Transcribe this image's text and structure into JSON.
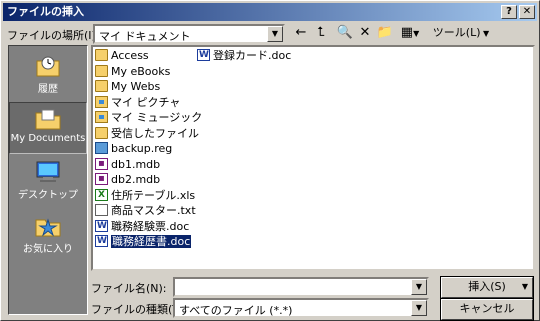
{
  "window": {
    "title": "ファイルの挿入",
    "help_label": "?",
    "close_label": "✕"
  },
  "toolbar": {
    "lookin_label": "ファイルの場所(I):",
    "lookin_value": "マイ ドキュメント",
    "back_icon": "←",
    "up_icon": "⮤",
    "search_icon": "🔍",
    "delete_icon": "✕",
    "newfolder_icon": "📁",
    "views_icon": "▦",
    "tools_label": "ツール(L)"
  },
  "places": [
    {
      "label": "履歴",
      "icon": "history-icon"
    },
    {
      "label": "My Documents",
      "icon": "my-documents-icon"
    },
    {
      "label": "デスクトップ",
      "icon": "desktop-icon"
    },
    {
      "label": "お気に入り",
      "icon": "favorites-icon"
    }
  ],
  "files": {
    "col1": [
      {
        "name": "Access",
        "type": "folder"
      },
      {
        "name": "My eBooks",
        "type": "folder"
      },
      {
        "name": "My Webs",
        "type": "folder"
      },
      {
        "name": "マイ ピクチャ",
        "type": "pic"
      },
      {
        "name": "マイ ミュージック",
        "type": "pic"
      },
      {
        "name": "受信したファイル",
        "type": "folder"
      },
      {
        "name": "backup.reg",
        "type": "reg"
      },
      {
        "name": "db1.mdb",
        "type": "mdb"
      },
      {
        "name": "db2.mdb",
        "type": "mdb"
      },
      {
        "name": "住所テーブル.xls",
        "type": "xls"
      },
      {
        "name": "商品マスター.txt",
        "type": "txt"
      },
      {
        "name": "職務経験票.doc",
        "type": "doc"
      },
      {
        "name": "職務経歴書.doc",
        "type": "doc",
        "selected": true
      }
    ],
    "col2": [
      {
        "name": "登録カード.doc",
        "type": "doc"
      }
    ]
  },
  "filename": {
    "label": "ファイル名(N):",
    "value": ""
  },
  "filetype": {
    "label": "ファイルの種類(T):",
    "value": "すべてのファイル (*.*)"
  },
  "buttons": {
    "insert": "挿入(S)",
    "cancel": "キャンセル"
  }
}
